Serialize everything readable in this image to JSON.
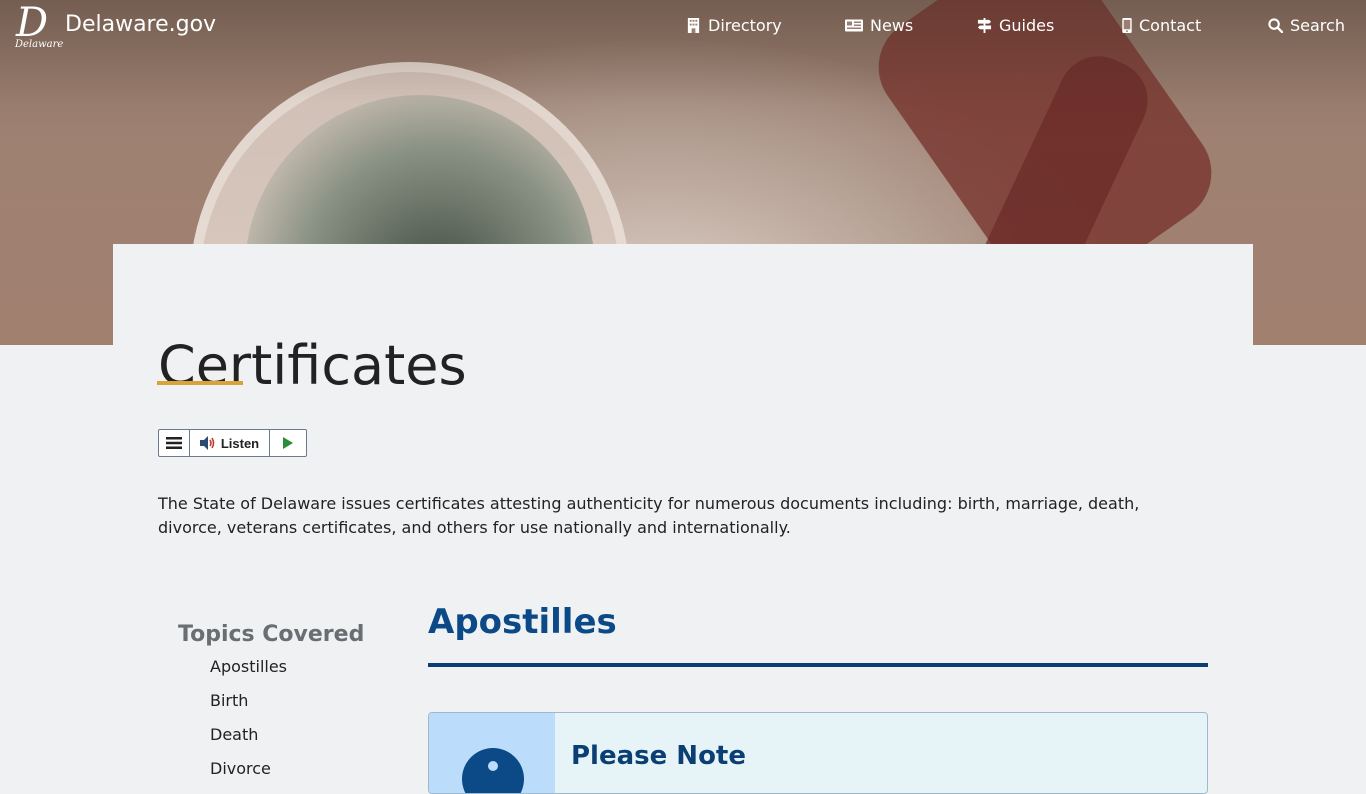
{
  "site": {
    "name": "Delaware.gov",
    "logo_text": "Delaware"
  },
  "nav": [
    {
      "label": "Directory",
      "icon": "building-icon"
    },
    {
      "label": "News",
      "icon": "newspaper-icon"
    },
    {
      "label": "Guides",
      "icon": "signpost-icon"
    },
    {
      "label": "Contact",
      "icon": "mobile-icon"
    },
    {
      "label": "Search",
      "icon": "search-icon"
    }
  ],
  "page": {
    "title": "Certificates",
    "intro": "The State of Delaware issues certificates attesting authenticity for numerous documents including: birth, marriage, death, divorce, veterans certificates, and others for use nationally and internationally."
  },
  "listen": {
    "label": "Listen"
  },
  "topics": {
    "title": "Topics Covered",
    "items": [
      "Apostilles",
      "Birth",
      "Death",
      "Divorce"
    ]
  },
  "section": {
    "title": "Apostilles"
  },
  "note": {
    "title": "Please Note"
  },
  "colors": {
    "accent": "#d8a43a",
    "brand_blue": "#0b4a87",
    "note_bg": "#e6f4f7",
    "note_side": "#bcdcfb"
  }
}
